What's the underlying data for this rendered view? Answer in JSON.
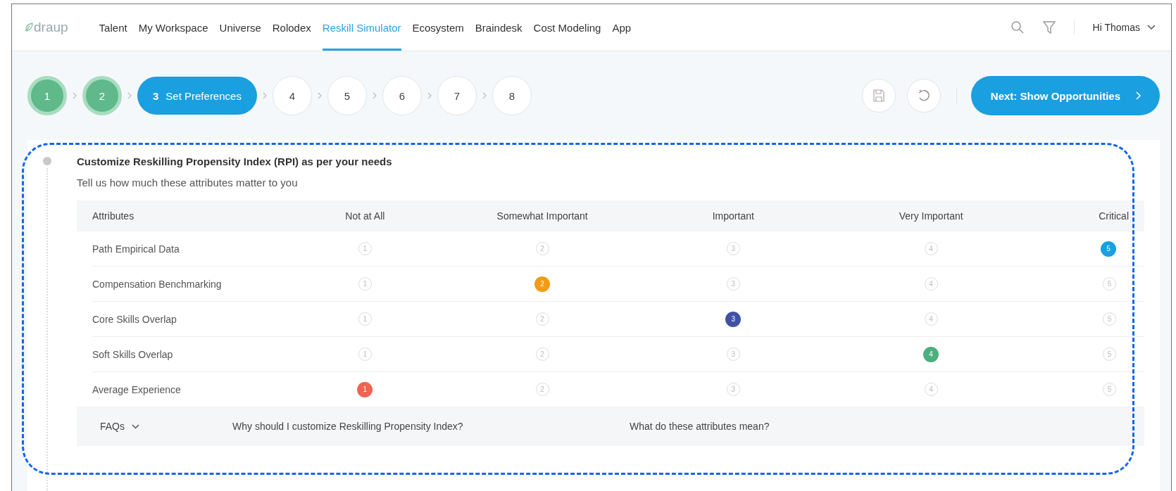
{
  "nav": {
    "logo": "draup",
    "items": [
      {
        "label": "Talent",
        "selected": false
      },
      {
        "label": "My Workspace",
        "selected": false
      },
      {
        "label": "Universe",
        "selected": false
      },
      {
        "label": "Rolodex",
        "selected": false
      },
      {
        "label": "Reskill Simulator",
        "selected": true
      },
      {
        "label": "Ecosystem",
        "selected": false
      },
      {
        "label": "Braindesk",
        "selected": false
      },
      {
        "label": "Cost Modeling",
        "selected": false
      },
      {
        "label": "App",
        "selected": false
      }
    ],
    "user": "Hi Thomas"
  },
  "steps": [
    {
      "number": "1",
      "completed": true,
      "selected": false
    },
    {
      "number": "2",
      "completed": true,
      "selected": false
    },
    {
      "number": "3",
      "label": "Set Preferences",
      "completed": false,
      "selected": true
    },
    {
      "number": "4",
      "completed": false,
      "selected": false
    },
    {
      "number": "5",
      "completed": false,
      "selected": false
    },
    {
      "number": "6",
      "completed": false,
      "selected": false
    },
    {
      "number": "7",
      "completed": false,
      "selected": false
    },
    {
      "number": "8",
      "completed": false,
      "selected": false
    }
  ],
  "next_button": "Next: Show Opportunities",
  "card": {
    "title": "Customize Reskilling Propensity Index (RPI) as per your needs",
    "subtitle": "Tell us how much these attributes matter to you",
    "table": {
      "columns": [
        "Attributes",
        "Not at All",
        "Somewhat Important",
        "Important",
        "Very Important",
        "Critical"
      ],
      "rows": [
        {
          "name": "Path Empirical Data",
          "color": "#1a9fe0",
          "options": [
            {
              "label": "1",
              "selected": false
            },
            {
              "label": "2",
              "selected": false
            },
            {
              "label": "3",
              "selected": false
            },
            {
              "label": "4",
              "selected": false
            },
            {
              "label": "5",
              "selected": true
            }
          ]
        },
        {
          "name": "Compensation Benchmarking",
          "color": "#f39c12",
          "options": [
            {
              "label": "1",
              "selected": false
            },
            {
              "label": "2",
              "selected": true
            },
            {
              "label": "3",
              "selected": false
            },
            {
              "label": "4",
              "selected": false
            },
            {
              "label": "5",
              "selected": false
            }
          ]
        },
        {
          "name": "Core Skills Overlap",
          "color": "#3f51a5",
          "options": [
            {
              "label": "1",
              "selected": false
            },
            {
              "label": "2",
              "selected": false
            },
            {
              "label": "3",
              "selected": true
            },
            {
              "label": "4",
              "selected": false
            },
            {
              "label": "5",
              "selected": false
            }
          ]
        },
        {
          "name": "Soft Skills Overlap",
          "color": "#4caf7d",
          "options": [
            {
              "label": "1",
              "selected": false
            },
            {
              "label": "2",
              "selected": false
            },
            {
              "label": "3",
              "selected": false
            },
            {
              "label": "4",
              "selected": true
            },
            {
              "label": "5",
              "selected": false
            }
          ]
        },
        {
          "name": "Average Experience",
          "color": "#ef6351",
          "options": [
            {
              "label": "1",
              "selected": true
            },
            {
              "label": "2",
              "selected": false
            },
            {
              "label": "3",
              "selected": false
            },
            {
              "label": "4",
              "selected": false
            },
            {
              "label": "5",
              "selected": false
            }
          ]
        }
      ]
    },
    "faq": {
      "label": "FAQs",
      "questions": [
        "Why should I customize Reskilling Propensity Index?",
        "What do these attributes mean?"
      ]
    }
  }
}
